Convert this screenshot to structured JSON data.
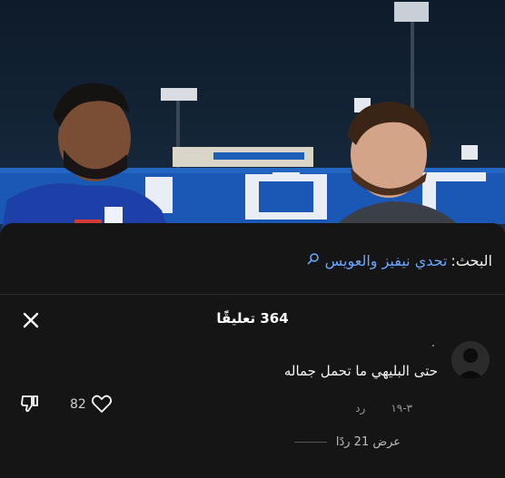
{
  "search": {
    "prefix": "البحث:",
    "query": "تحدي نيفيز والعويس"
  },
  "comments_header": {
    "count_label": "364 تعليقًا"
  },
  "comment": {
    "author": ".",
    "text": "حتى البليهي ما تحمل جماله",
    "date": "٣-١٩",
    "reply_label": "رد",
    "likes": "82",
    "view_replies_label": "عرض 21 ردًا"
  },
  "colors": {
    "sheet_bg": "#151515",
    "accent_link": "#6aa6ff"
  }
}
